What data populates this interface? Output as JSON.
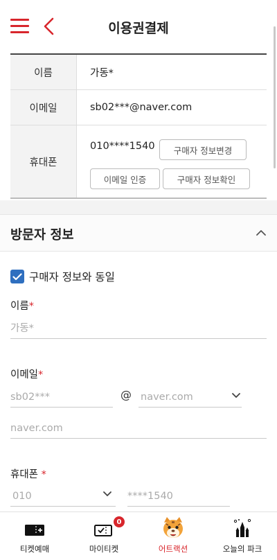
{
  "header": {
    "title": "이용권결제"
  },
  "buyer_info": {
    "name_label": "이름",
    "name_value": "가동*",
    "email_label": "이메일",
    "email_value": "sb02***@naver.com",
    "phone_label": "휴대폰",
    "phone_value": "010****1540",
    "change_button": "구매자 정보변경",
    "email_auth_button": "이메일 인증",
    "confirm_button": "구매자 정보확인"
  },
  "visitor": {
    "section_title": "방문자 정보",
    "same_as_buyer_label": "구매자 정보와 동일",
    "same_as_buyer_checked": true,
    "name_label": "이름",
    "name_placeholder": "가동*",
    "email_label": "이메일",
    "email_id_placeholder": "sb02***",
    "at_sign": "@",
    "email_domain_selected": "naver.com",
    "email_domain_input": "naver.com",
    "phone_label": "휴대폰",
    "phone_prefix_selected": "010",
    "phone_number_placeholder": "****1540",
    "required_mark": "*"
  },
  "bottom_nav": {
    "items": [
      {
        "label": "티켓예매",
        "icon": "ticket-icon"
      },
      {
        "label": "마이티켓",
        "icon": "my-ticket-icon",
        "badge": "0"
      },
      {
        "label": "어트랙션",
        "icon": "tiger-mascot-icon",
        "active": true
      },
      {
        "label": "오늘의 파크",
        "icon": "castle-icon"
      }
    ]
  },
  "colors": {
    "accent": "#d8262c",
    "checkbox": "#2f6fbf"
  }
}
